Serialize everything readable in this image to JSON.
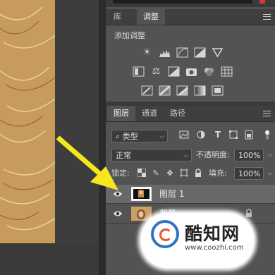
{
  "adjust_panel": {
    "tabs": [
      {
        "label": "库"
      },
      {
        "label": "调整"
      }
    ],
    "title": "添加调整"
  },
  "layers_panel": {
    "tabs": [
      {
        "label": "图层"
      },
      {
        "label": "通道"
      },
      {
        "label": "路径"
      }
    ],
    "filter_dropdown": "类型",
    "blend_mode": "正常",
    "opacity_label": "不透明度:",
    "opacity_value": "100%",
    "lock_label": "锁定:",
    "fill_label": "填充:",
    "fill_value": "100%",
    "layers": [
      {
        "name": "图层 1",
        "selected": true
      },
      {
        "name": "背景",
        "selected": false
      }
    ]
  },
  "watermark": {
    "title": "酷知网",
    "url": "www.coozhi.com"
  },
  "colors": {
    "arrow": "#f5e61d",
    "panel_bg": "#535353",
    "tab_active": "#535353",
    "selected_layer": "#696969"
  }
}
